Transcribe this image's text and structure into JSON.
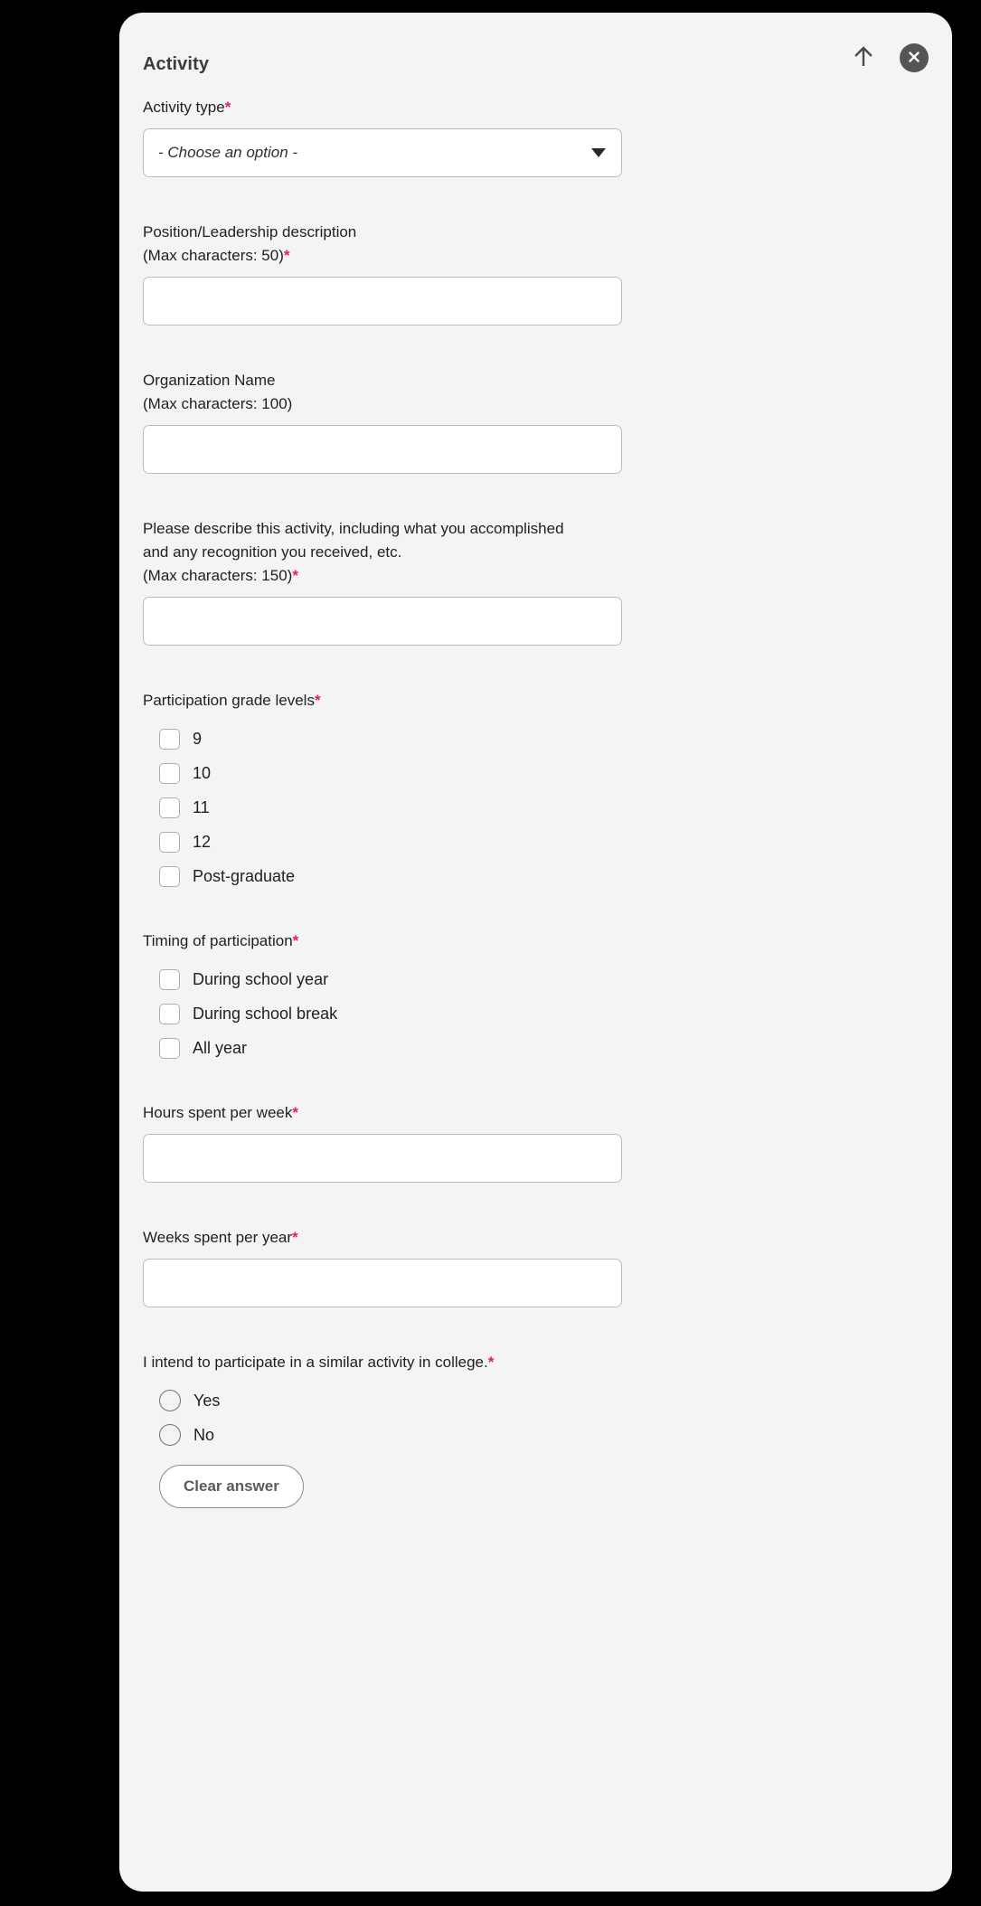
{
  "dialog": {
    "title": "Activity",
    "actions": [
      {
        "name": "collapse-up-icon",
        "icon": "arrow-up-icon",
        "label": ""
      },
      {
        "name": "close-icon",
        "icon": "close-circle-icon",
        "label": ""
      }
    ]
  },
  "form": {
    "activity_type": {
      "label": "Activity type",
      "required_marker": "*",
      "placeholder": "- Choose an option -",
      "value": ""
    },
    "position_description": {
      "label_line1": "Position/Leadership description",
      "label_line2": "(Max characters: 50)",
      "required_marker": "*",
      "value": ""
    },
    "organization_name": {
      "label_line1": "Organization Name",
      "label_line2": "(Max characters: 100)",
      "required_marker": "",
      "value": ""
    },
    "activity_description": {
      "label_line1": "Please describe this activity, including what you accomplished",
      "label_line2": "and any recognition you received, etc.",
      "label_line3": "(Max characters: 150)",
      "required_marker": "*",
      "value": ""
    },
    "grade_levels": {
      "label": "Participation grade levels",
      "required_marker": "*",
      "options": [
        {
          "label": "9",
          "checked": false
        },
        {
          "label": "10",
          "checked": false
        },
        {
          "label": "11",
          "checked": false
        },
        {
          "label": "12",
          "checked": false
        },
        {
          "label": "Post-graduate",
          "checked": false
        }
      ]
    },
    "timing": {
      "label": "Timing of participation",
      "required_marker": "*",
      "options": [
        {
          "label": "During school year",
          "checked": false
        },
        {
          "label": "During school break",
          "checked": false
        },
        {
          "label": "All year",
          "checked": false
        }
      ]
    },
    "hours_per_week": {
      "label": "Hours spent per week",
      "required_marker": "*",
      "value": ""
    },
    "weeks_per_year": {
      "label": "Weeks spent per year",
      "required_marker": "*",
      "value": ""
    },
    "college_intent": {
      "label": "I intend to participate in a similar activity in college.",
      "required_marker": "*",
      "options": [
        {
          "label": "Yes",
          "selected": false
        },
        {
          "label": "No",
          "selected": false
        }
      ],
      "clear_label": "Clear answer"
    }
  },
  "colors": {
    "required_asterisk": "#e8204b",
    "card_background": "#f4f4f4",
    "page_background": "#000000",
    "close_button": "#555555",
    "input_border": "#bcbcbc"
  }
}
